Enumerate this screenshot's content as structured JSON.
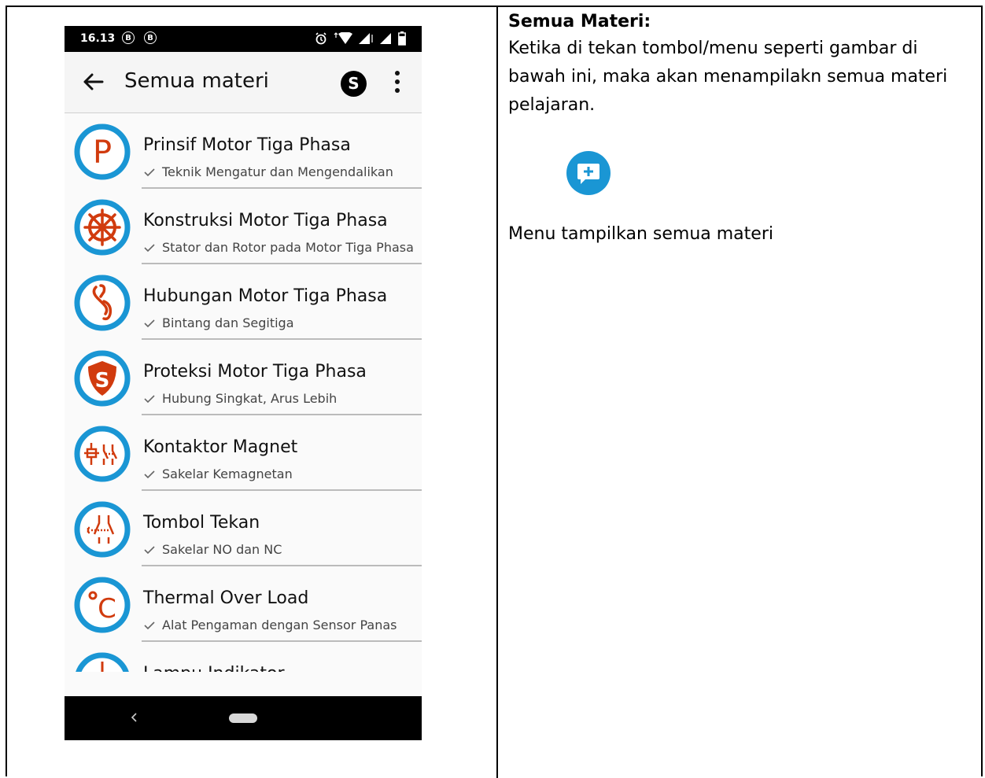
{
  "phone": {
    "status": {
      "time": "16.13",
      "indicator_1": "B",
      "indicator_2": "B",
      "icons": [
        "alarm-icon",
        "wifi-icon",
        "signal-icon",
        "signal-icon",
        "battery-icon"
      ]
    },
    "app_bar": {
      "title": "Semua materi",
      "avatar_letter": "S"
    },
    "items": [
      {
        "title": "Prinsif Motor Tiga Phasa",
        "subtitle": "Teknik Mengatur dan Mengendalikan",
        "icon": "letter-p-icon"
      },
      {
        "title": "Konstruksi Motor Tiga Phasa",
        "subtitle": "Stator dan Rotor pada Motor Tiga Phasa",
        "icon": "wheel-icon"
      },
      {
        "title": "Hubungan Motor Tiga Phasa",
        "subtitle": "Bintang dan Segitiga",
        "icon": "link-icon"
      },
      {
        "title": "Proteksi Motor Tiga Phasa",
        "subtitle": "Hubung Singkat, Arus Lebih",
        "icon": "shield-s-icon"
      },
      {
        "title": "Kontaktor Magnet",
        "subtitle": "Sakelar Kemagnetan",
        "icon": "contactor-icon"
      },
      {
        "title": "Tombol Tekan",
        "subtitle": "Sakelar NO dan NC",
        "icon": "pushbutton-icon"
      },
      {
        "title": "Thermal Over Load",
        "subtitle": "Alat Pengaman dengan Sensor Panas",
        "icon": "celsius-icon"
      },
      {
        "title": "Lampu Indikator",
        "subtitle": "",
        "icon": "lamp-icon"
      }
    ],
    "colors": {
      "icon_ring": "#1a96d4",
      "icon_accent": "#d13b0e"
    }
  },
  "doc": {
    "heading": "Semua Materi:",
    "paragraph": "Ketika di tekan tombol/menu seperti gambar di bawah ini, maka akan menampilakn semua materi pelajaran.",
    "caption": "Menu tampilkan semua materi",
    "icon": "add-comment-icon",
    "icon_color": "#1a96d4"
  }
}
